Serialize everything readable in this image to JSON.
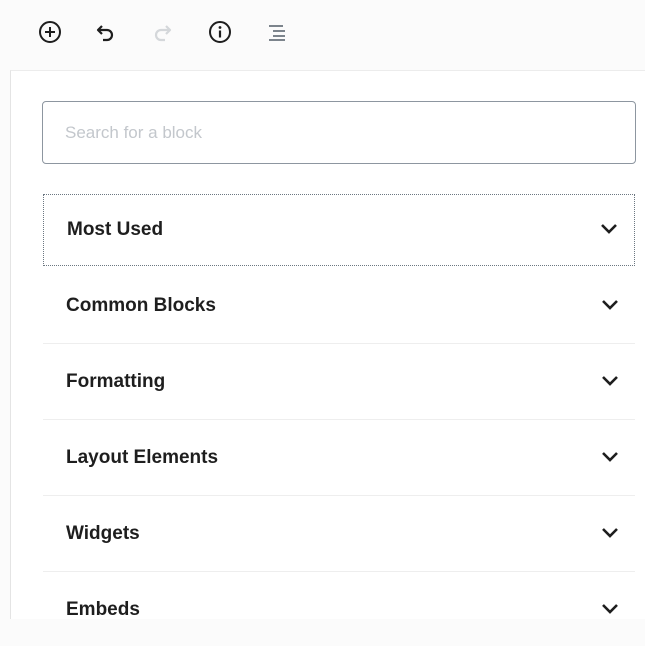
{
  "toolbar": {
    "icons": [
      {
        "name": "add-block-icon",
        "label": "Add block"
      },
      {
        "name": "undo-icon",
        "label": "Undo"
      },
      {
        "name": "redo-icon",
        "label": "Redo"
      },
      {
        "name": "info-icon",
        "label": "Content structure"
      },
      {
        "name": "block-navigation-icon",
        "label": "Block navigation"
      }
    ],
    "redo_disabled": true
  },
  "search": {
    "placeholder": "Search for a block"
  },
  "categories": [
    {
      "label": "Most Used",
      "focused": true
    },
    {
      "label": "Common Blocks",
      "focused": false
    },
    {
      "label": "Formatting",
      "focused": false
    },
    {
      "label": "Layout Elements",
      "focused": false
    },
    {
      "label": "Widgets",
      "focused": false
    },
    {
      "label": "Embeds",
      "focused": false
    }
  ],
  "colors": {
    "icon": "#1e1e1e",
    "icon_disabled": "#d4d7da",
    "search_border": "#8d96a0",
    "placeholder": "#c3c7cc",
    "focus_outline": "#6c7781"
  }
}
